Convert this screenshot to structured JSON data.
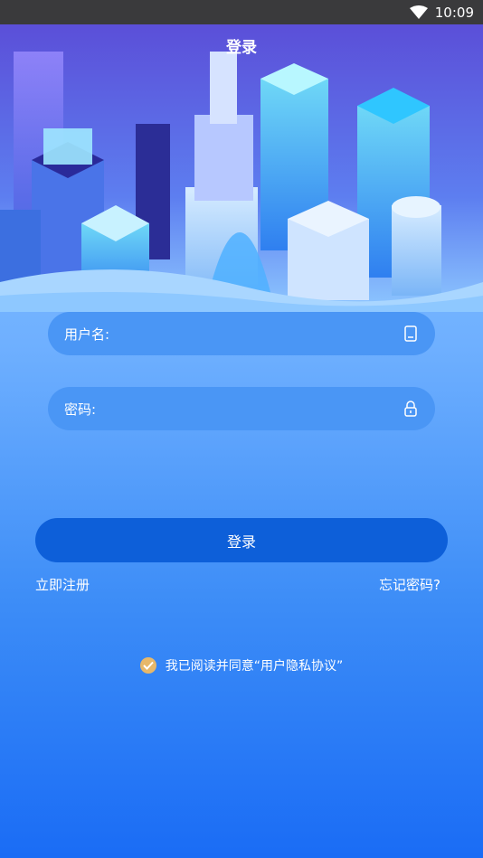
{
  "statusbar": {
    "time": "10:09"
  },
  "page": {
    "title": "登录"
  },
  "form": {
    "username_label": "用户名:",
    "username_value": "",
    "password_label": "密码:",
    "password_value": "",
    "login_label": "登录"
  },
  "links": {
    "register": "立即注册",
    "forgot": "忘记密码?"
  },
  "agreement": {
    "text": "我已阅读并同意“用户隐私协议”",
    "checked": true
  },
  "colors": {
    "accent": "#0d5fd9",
    "check": "#e7b86a"
  }
}
